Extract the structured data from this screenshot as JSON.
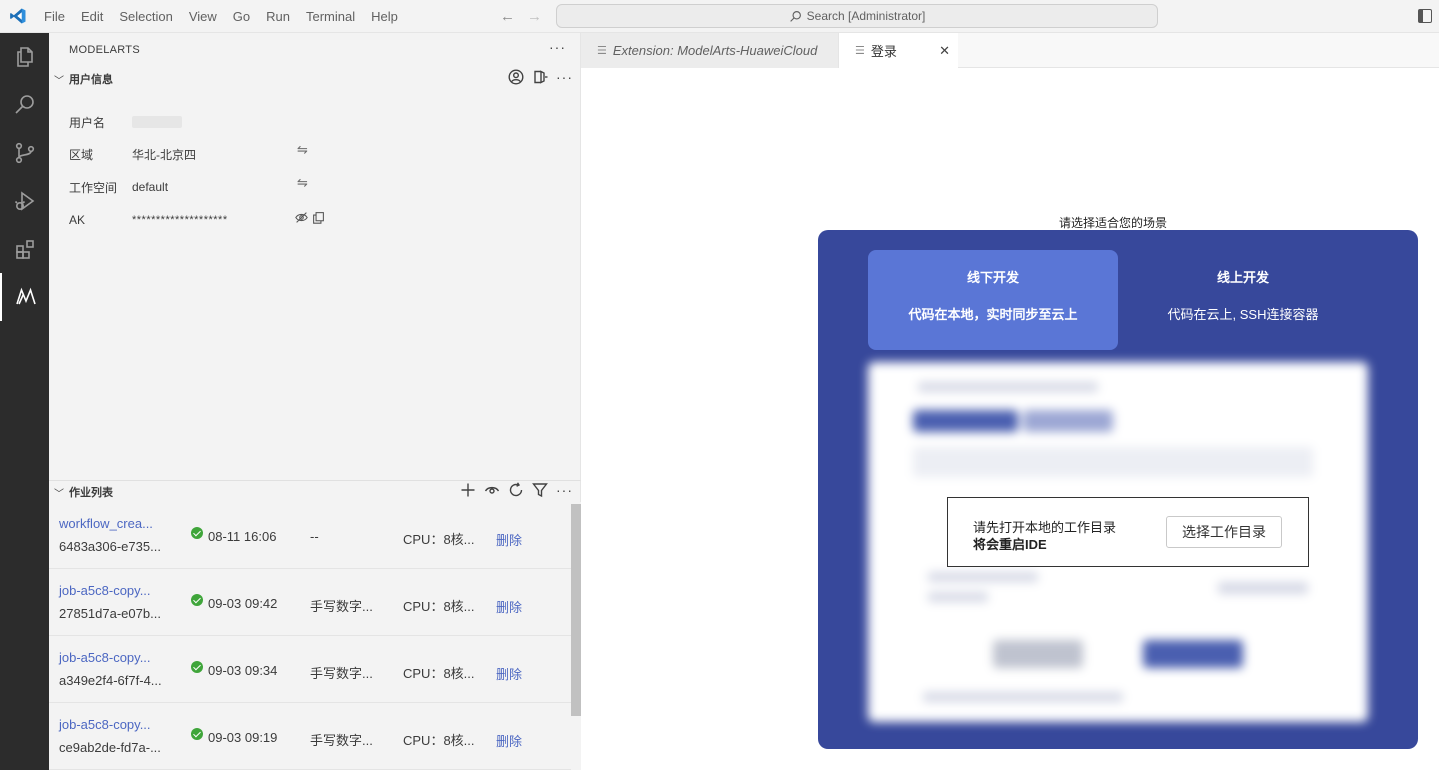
{
  "menu": [
    "File",
    "Edit",
    "Selection",
    "View",
    "Go",
    "Run",
    "Terminal",
    "Help"
  ],
  "search": {
    "placeholder": "Search [Administrator]"
  },
  "sidebar": {
    "title": "MODELARTS",
    "more": "···",
    "user_section": {
      "label": "用户信息",
      "rows": [
        {
          "key": "用户名",
          "value": ""
        },
        {
          "key": "区域",
          "value": "华北-北京四"
        },
        {
          "key": "工作空间",
          "value": "default"
        },
        {
          "key": "AK",
          "value": "********************"
        }
      ]
    },
    "jobs_section": {
      "label": "作业列表",
      "jobs": [
        {
          "name": "workflow_crea...",
          "id": "6483a306-e735...",
          "time": "08-11 16:06",
          "desc": "--",
          "resource": "CPU：8核...",
          "action": "删除"
        },
        {
          "name": "job-a5c8-copy...",
          "id": "27851d7a-e07b...",
          "time": "09-03 09:42",
          "desc": "手写数字...",
          "resource": "CPU：8核...",
          "action": "删除"
        },
        {
          "name": "job-a5c8-copy...",
          "id": "a349e2f4-6f7f-4...",
          "time": "09-03 09:34",
          "desc": "手写数字...",
          "resource": "CPU：8核...",
          "action": "删除"
        },
        {
          "name": "job-a5c8-copy...",
          "id": "ce9ab2de-fd7a-...",
          "time": "09-03 09:19",
          "desc": "手写数字...",
          "resource": "CPU：8核...",
          "action": "删除"
        }
      ]
    }
  },
  "tabs": {
    "extension": "Extension: ModelArts-HuaweiCloud",
    "login": "登录"
  },
  "login_page": {
    "scene_title": "请选择适合您的场景",
    "options": [
      {
        "title": "线下开发",
        "desc": "代码在本地，实时同步至云上"
      },
      {
        "title": "线上开发",
        "desc": "代码在云上, SSH连接容器"
      }
    ],
    "dialog": {
      "line1": "请先打开本地的工作目录",
      "line2": "将会重启IDE",
      "button": "选择工作目录"
    }
  },
  "colors": {
    "accent": "#37489b",
    "option_active": "#5a76d6",
    "link": "#4c67c2",
    "success": "#3fa53a"
  }
}
